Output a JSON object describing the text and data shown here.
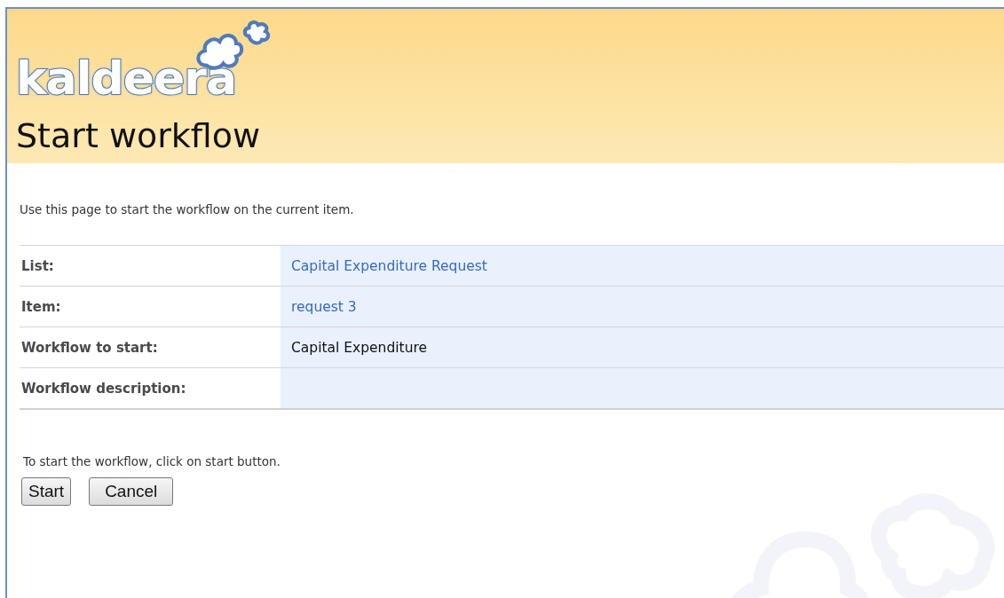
{
  "logo": {
    "text": "kaldeera"
  },
  "page_title": "Start workflow",
  "intro": "Use this page to start the workflow on the current item.",
  "fields": [
    {
      "label": "List:",
      "value": "Capital Expenditure Request",
      "kind": "link"
    },
    {
      "label": "Item:",
      "value": "request 3",
      "kind": "link"
    },
    {
      "label": "Workflow to start:",
      "value": "Capital Expenditure",
      "kind": "plain"
    },
    {
      "label": "Workflow description:",
      "kind": "plain"
    }
  ],
  "instruction": "To start the workflow, click on start button.",
  "buttons": [
    "Start",
    "Cancel"
  ]
}
